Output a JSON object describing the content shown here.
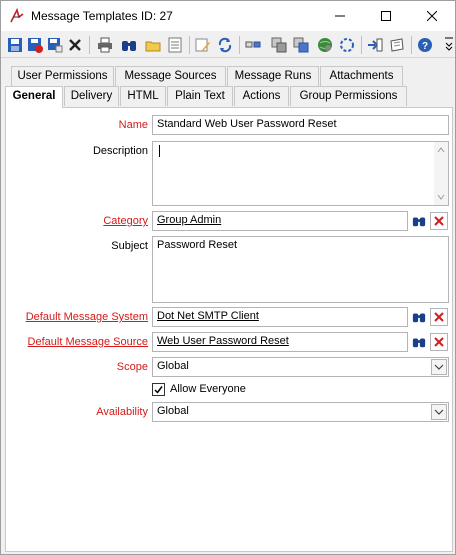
{
  "window": {
    "title": "Message Templates ID: 27"
  },
  "toolbar": {
    "icons": [
      "save-icon",
      "save-close-icon",
      "save-new-icon",
      "delete-icon",
      "print-icon",
      "find-icon",
      "open-icon",
      "list-icon",
      "edit-icon",
      "refresh-icon",
      "link-icon",
      "copy-icon",
      "copy-all-icon",
      "globe-icon",
      "settings-icon",
      "export-icon",
      "note-icon",
      "help-icon"
    ]
  },
  "tabs": {
    "row1": [
      "User Permissions",
      "Message Sources",
      "Message Runs",
      "Attachments"
    ],
    "row2": [
      "General",
      "Delivery",
      "HTML",
      "Plain Text",
      "Actions",
      "Group Permissions"
    ]
  },
  "form": {
    "name_label": "Name",
    "name_value": "Standard Web User Password Reset",
    "description_label": "Description",
    "description_value": "",
    "category_label": "Category",
    "category_value": "Group Admin",
    "subject_label": "Subject",
    "subject_value": "Password Reset",
    "message_system_label": "Default Message System",
    "message_system_value": "Dot Net SMTP Client",
    "message_source_label": "Default Message Source",
    "message_source_value": "Web User Password Reset",
    "scope_label": "Scope",
    "scope_value": "Global",
    "allow_everyone_label": "Allow Everyone",
    "allow_everyone_checked": true,
    "availability_label": "Availability",
    "availability_value": "Global"
  },
  "colors": {
    "required_label": "#d51a1a",
    "accent": "#1f4e9e"
  }
}
